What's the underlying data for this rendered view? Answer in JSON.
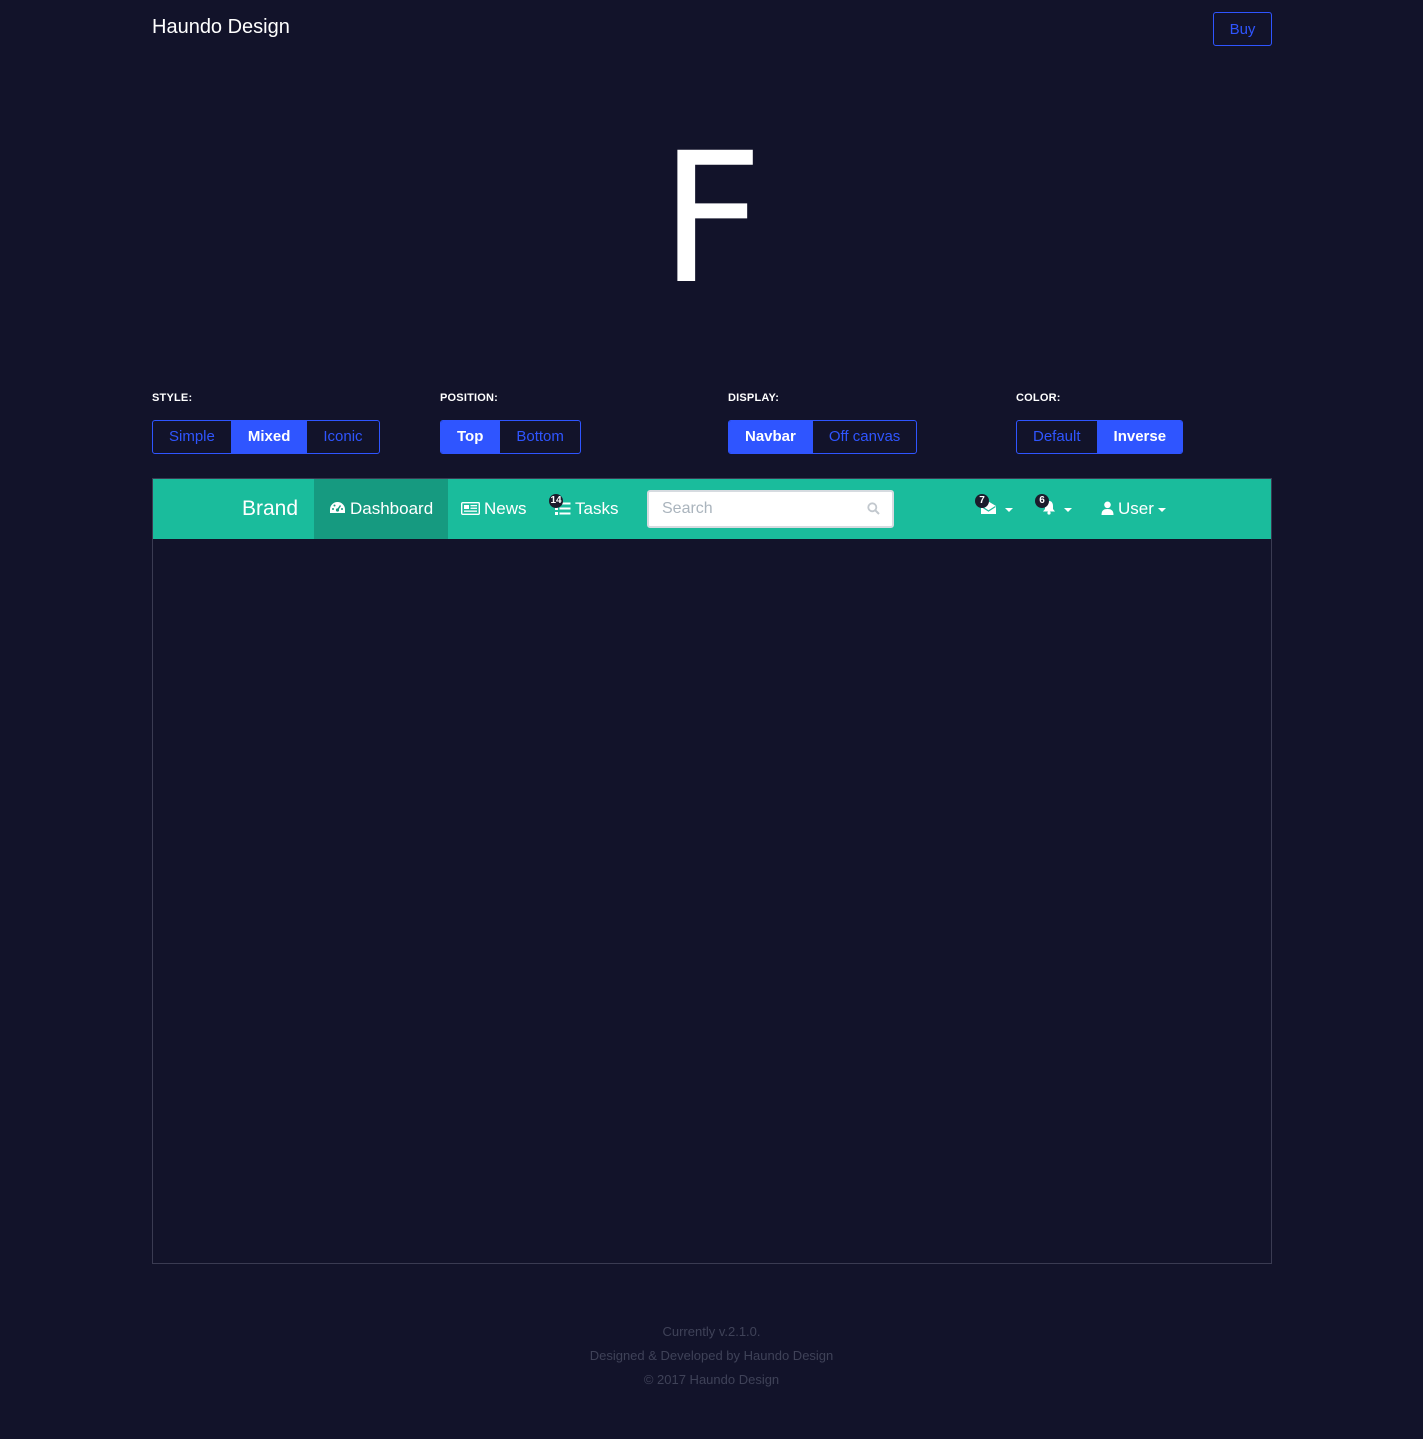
{
  "header": {
    "site_title": "Haundo Design",
    "buy_label": "Buy"
  },
  "logo": {
    "letter": "F"
  },
  "options": {
    "style": {
      "label": "STYLE:",
      "buttons": [
        "Simple",
        "Mixed",
        "Iconic"
      ],
      "active": "Mixed"
    },
    "position": {
      "label": "POSITION:",
      "buttons": [
        "Top",
        "Bottom"
      ],
      "active": "Top"
    },
    "display": {
      "label": "DISPLAY:",
      "buttons": [
        "Navbar",
        "Off canvas"
      ],
      "active": "Navbar"
    },
    "color": {
      "label": "COLOR:",
      "buttons": [
        "Default",
        "Inverse"
      ],
      "active": "Inverse"
    }
  },
  "preview_navbar": {
    "brand": "Brand",
    "items": [
      {
        "label": "Dashboard",
        "icon": "dashboard-icon",
        "active": true
      },
      {
        "label": "News",
        "icon": "newspaper-icon",
        "active": false
      },
      {
        "label": "Tasks",
        "icon": "tasks-icon",
        "badge": "14",
        "active": false
      }
    ],
    "search_placeholder": "Search",
    "messages_badge": "7",
    "notifications_badge": "6",
    "user_label": "User"
  },
  "footer": {
    "version": "Currently v.2.1.0.",
    "credit": "Designed & Developed by Haundo Design",
    "copyright": "© 2017 Haundo Design"
  },
  "colors": {
    "background": "#12132a",
    "accent": "#2f55ff",
    "navbar": "#1abc9c",
    "navbar_active": "#169a80"
  }
}
